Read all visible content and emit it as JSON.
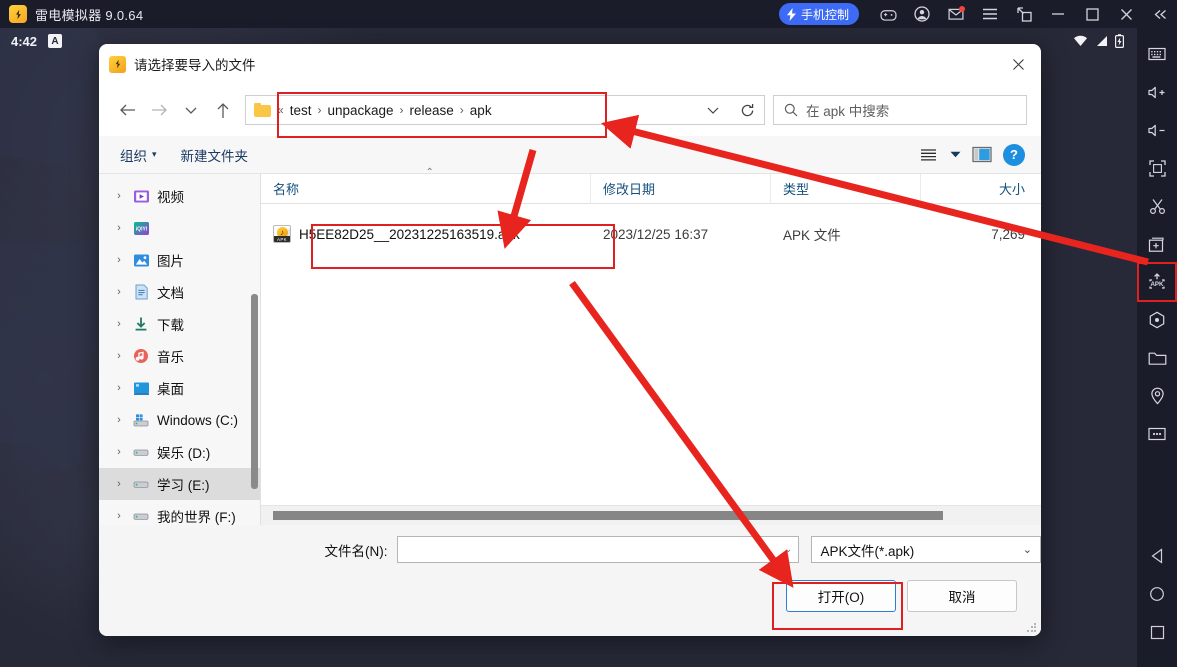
{
  "emulator": {
    "title": "雷电模拟器 9.0.64",
    "logo_glyph": "♪",
    "phone_control_label": "手机控制",
    "titlebar_icons": [
      {
        "name": "gamepad-icon"
      },
      {
        "name": "account-icon"
      },
      {
        "name": "mail-icon"
      },
      {
        "name": "menu-icon"
      },
      {
        "name": "multi-instance-icon"
      },
      {
        "name": "minimize-icon"
      },
      {
        "name": "maximize-icon"
      },
      {
        "name": "close-icon"
      },
      {
        "name": "collapse-icon"
      }
    ]
  },
  "android_status": {
    "time": "4:42",
    "ime_badge": "A",
    "wifi": "wifi-icon",
    "signal": "signal-icon",
    "battery": "battery-charging-icon"
  },
  "toolbar_right": {
    "items": [
      {
        "name": "keyboard-icon"
      },
      {
        "name": "volume-up-icon"
      },
      {
        "name": "volume-down-icon"
      },
      {
        "name": "fullscreen-icon"
      },
      {
        "name": "scissors-icon"
      },
      {
        "name": "add-app-icon"
      },
      {
        "name": "install-apk-icon",
        "highlighted": true
      },
      {
        "name": "shake-icon"
      },
      {
        "name": "shared-folder-icon"
      },
      {
        "name": "location-icon"
      },
      {
        "name": "more-icon"
      }
    ],
    "nav": [
      {
        "name": "nav-back-icon"
      },
      {
        "name": "nav-home-icon"
      },
      {
        "name": "nav-recents-icon"
      }
    ]
  },
  "dialog": {
    "title": "请选择要导入的文件",
    "logo_glyph": "♪",
    "close_glyph": "✕",
    "nav": {
      "back": "←",
      "forward": "→",
      "recent": "⌄",
      "up": "↑"
    },
    "breadcrumb": {
      "prefix": "«",
      "items": [
        "test",
        "unpackage",
        "release",
        "apk"
      ],
      "separator": "›",
      "dropdown_glyph": "⌄",
      "refresh_glyph": "⟳"
    },
    "search": {
      "placeholder": "在 apk 中搜索",
      "icon": "search-icon"
    },
    "commandbar": {
      "organize": "组织",
      "organize_caret": "▾",
      "new_folder": "新建文件夹",
      "view_icon": "view-options-icon",
      "view_caret": "▾",
      "preview_icon": "preview-pane-icon",
      "help_label": "?"
    },
    "tree": {
      "items": [
        {
          "label": "视频",
          "icon": "video-folder-icon",
          "selected": false
        },
        {
          "label": "",
          "icon": "iqiyi-icon",
          "selected": false
        },
        {
          "label": "图片",
          "icon": "pictures-folder-icon",
          "selected": false
        },
        {
          "label": "文档",
          "icon": "documents-folder-icon",
          "selected": false
        },
        {
          "label": "下载",
          "icon": "downloads-folder-icon",
          "selected": false
        },
        {
          "label": "音乐",
          "icon": "music-folder-icon",
          "selected": false
        },
        {
          "label": "桌面",
          "icon": "desktop-folder-icon",
          "selected": false
        },
        {
          "label": "Windows (C:)",
          "icon": "system-drive-icon",
          "selected": false
        },
        {
          "label": "娱乐 (D:)",
          "icon": "drive-icon",
          "selected": false
        },
        {
          "label": "学习 (E:)",
          "icon": "drive-icon",
          "selected": true
        },
        {
          "label": "我的世界 (F:)",
          "icon": "drive-icon",
          "selected": false
        }
      ],
      "expander_glyph": "›"
    },
    "filelist": {
      "columns": [
        "名称",
        "修改日期",
        "类型",
        "大小"
      ],
      "sort_caret": "⌃",
      "rows": [
        {
          "name": "H5EE82D25__20231225163519.apk",
          "date": "2023/12/25 16:37",
          "type": "APK 文件",
          "size": "7,269",
          "icon": "apk-file-icon"
        }
      ]
    },
    "footer": {
      "filename_label": "文件名(N):",
      "filename_value": "",
      "filename_caret": "⌄",
      "filetype_value": "APK文件(*.apk)",
      "filetype_caret": "⌄",
      "open_button": "打开(O)",
      "cancel_button": "取消"
    }
  },
  "annotations": {
    "accent_color": "#e02020",
    "boxes": [
      "breadcrumb-highlight",
      "file-row-highlight",
      "open-button-highlight"
    ],
    "arrows": [
      "apk-tool-to-breadcrumb",
      "breadcrumb-to-file-row",
      "file-row-to-open-button"
    ]
  }
}
